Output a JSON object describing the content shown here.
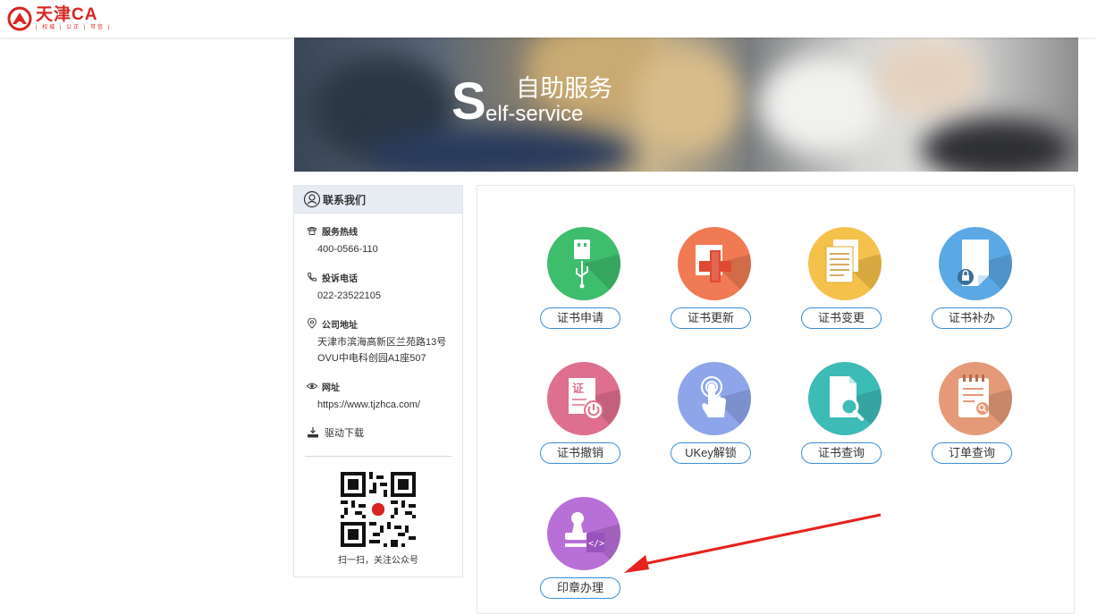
{
  "header": {
    "logo_text": "天津CA",
    "logo_subtitle": "| 权威 | 公正 | 可信 |",
    "logo_icon": "tianjin-ca-logo"
  },
  "banner": {
    "letter": "S",
    "title_cn": "自助服务",
    "title_en": "elf-service"
  },
  "contact": {
    "heading": "联系我们",
    "items": [
      {
        "icon": "phone-icon",
        "label": "服务热线",
        "value": "400-0566-110"
      },
      {
        "icon": "complaint-phone-icon",
        "label": "投诉电话",
        "value": "022-23522105"
      },
      {
        "icon": "location-icon",
        "label": "公司地址",
        "value_lines": [
          "天津市滨海高新区兰苑路13号",
          "OVU中电科创园A1座507"
        ]
      },
      {
        "icon": "eye-icon",
        "label": "网址",
        "value": "https://www.tjzhca.com/"
      }
    ],
    "driver_download": "驱动下载",
    "qr_caption": "扫一扫，关注公众号"
  },
  "services": [
    {
      "label": "证书申请",
      "icon": "usb-icon",
      "color": "#3ebd6d"
    },
    {
      "label": "证书更新",
      "icon": "medical-cross-icon",
      "color": "#f07a54"
    },
    {
      "label": "证书变更",
      "icon": "documents-icon",
      "color": "#f4c14b"
    },
    {
      "label": "证书补办",
      "icon": "lock-document-icon",
      "color": "#5aa8e4"
    },
    {
      "label": "证书撤销",
      "icon": "revoke-certificate-icon",
      "color": "#de6f8e"
    },
    {
      "label": "UKey解锁",
      "icon": "touch-hand-icon",
      "color": "#8ea6e9"
    },
    {
      "label": "证书查询",
      "icon": "search-document-icon",
      "color": "#3dbbb7"
    },
    {
      "label": "订单查询",
      "icon": "order-search-icon",
      "color": "#e49a78"
    },
    {
      "label": "印章办理",
      "icon": "stamp-icon",
      "color": "#b86fd6"
    }
  ],
  "annotation": {
    "color": "#e8211c"
  }
}
